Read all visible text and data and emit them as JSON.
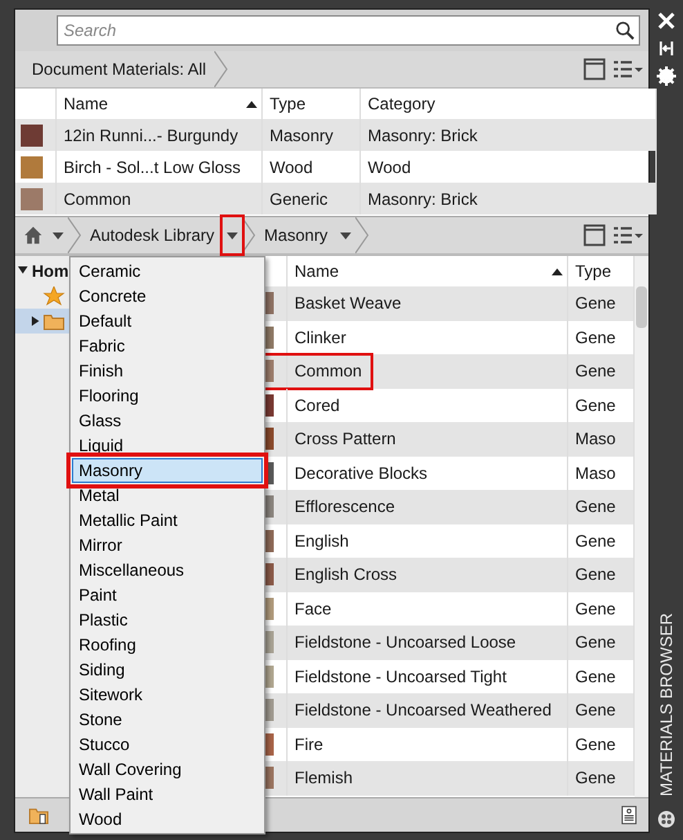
{
  "search": {
    "placeholder": "Search"
  },
  "document_materials": {
    "breadcrumb": "Document Materials: All",
    "columns": [
      {
        "label": "Name",
        "sorted": true
      },
      {
        "label": "Type",
        "sorted": false
      },
      {
        "label": "Category",
        "sorted": false
      }
    ],
    "rows": [
      {
        "name": "12in Runni...- Burgundy",
        "type": "Masonry",
        "category": "Masonry: Brick",
        "color": "#6e3b34"
      },
      {
        "name": "Birch - Sol...t Low Gloss",
        "type": "Wood",
        "category": "Wood",
        "color": "#b07a3c"
      },
      {
        "name": "Common",
        "type": "Generic",
        "category": "Masonry: Brick",
        "color": "#9c7a68"
      }
    ]
  },
  "library": {
    "breadcrumb": [
      {
        "label": "Autodesk Library",
        "callout": true
      },
      {
        "label": "Masonry",
        "callout": false
      }
    ],
    "tree": {
      "label": "Hom",
      "expanded": true,
      "children": [
        {
          "kind": "star",
          "selected": false
        },
        {
          "kind": "folder",
          "selected": true,
          "expanded": false
        }
      ]
    },
    "columns": [
      {
        "label": "Name",
        "sorted": true
      },
      {
        "label": "Type",
        "sorted": false
      }
    ],
    "rows": [
      {
        "name": "Basket Weave",
        "type": "Gene",
        "color": "#8e7264",
        "callout": false
      },
      {
        "name": "Clinker",
        "type": "Gene",
        "color": "#8f7a66",
        "callout": false
      },
      {
        "name": "Common",
        "type": "Gene",
        "color": "#9c7d6c",
        "callout": true
      },
      {
        "name": "Cored",
        "type": "Gene",
        "color": "#7a3a33",
        "callout": false
      },
      {
        "name": "Cross Pattern",
        "type": "Maso",
        "color": "#8a4a2c",
        "callout": false
      },
      {
        "name": "Decorative Blocks",
        "type": "Maso",
        "color": "#5a5a5a",
        "callout": false
      },
      {
        "name": "Efflorescence",
        "type": "Gene",
        "color": "#8a847e",
        "callout": false
      },
      {
        "name": "English",
        "type": "Gene",
        "color": "#8e6a58",
        "callout": false
      },
      {
        "name": "English Cross",
        "type": "Gene",
        "color": "#8a5a48",
        "callout": false
      },
      {
        "name": "Face",
        "type": "Gene",
        "color": "#b09a7c",
        "callout": false
      },
      {
        "name": "Fieldstone - Uncoarsed Loose",
        "type": "Gene",
        "color": "#a8a294",
        "callout": false
      },
      {
        "name": "Fieldstone - Uncoarsed Tight",
        "type": "Gene",
        "color": "#b0a690",
        "callout": false
      },
      {
        "name": "Fieldstone - Uncoarsed Weathered",
        "type": "Gene",
        "color": "#a09a90",
        "callout": false
      },
      {
        "name": "Fire",
        "type": "Gene",
        "color": "#a86448",
        "callout": false
      },
      {
        "name": "Flemish",
        "type": "Gene",
        "color": "#9a7460",
        "callout": false
      }
    ],
    "menu": [
      {
        "label": "Ceramic",
        "selected": false
      },
      {
        "label": "Concrete",
        "selected": false
      },
      {
        "label": "Default",
        "selected": false
      },
      {
        "label": "Fabric",
        "selected": false
      },
      {
        "label": "Finish",
        "selected": false
      },
      {
        "label": "Flooring",
        "selected": false
      },
      {
        "label": "Glass",
        "selected": false
      },
      {
        "label": "Liquid",
        "selected": false
      },
      {
        "label": "Masonry",
        "selected": true
      },
      {
        "label": "Metal",
        "selected": false
      },
      {
        "label": "Metallic Paint",
        "selected": false
      },
      {
        "label": "Mirror",
        "selected": false
      },
      {
        "label": "Miscellaneous",
        "selected": false
      },
      {
        "label": "Paint",
        "selected": false
      },
      {
        "label": "Plastic",
        "selected": false
      },
      {
        "label": "Roofing",
        "selected": false
      },
      {
        "label": "Siding",
        "selected": false
      },
      {
        "label": "Sitework",
        "selected": false
      },
      {
        "label": "Stone",
        "selected": false
      },
      {
        "label": "Stucco",
        "selected": false
      },
      {
        "label": "Wall Covering",
        "selected": false
      },
      {
        "label": "Wall Paint",
        "selected": false
      },
      {
        "label": "Wood",
        "selected": false
      }
    ]
  },
  "side_title": "MATERIALS BROWSER"
}
